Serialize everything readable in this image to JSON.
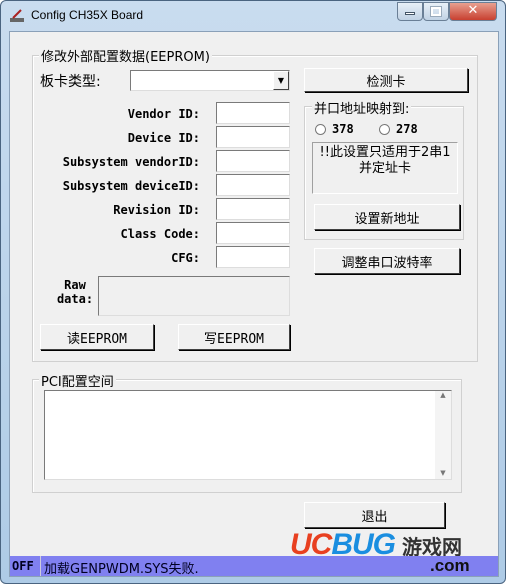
{
  "window": {
    "title": "Config CH35X Board"
  },
  "eeprom": {
    "legend": "修改外部配置数据(EEPROM)",
    "board_type_label": "板卡类型:",
    "board_type_value": "",
    "detect_button": "检测卡",
    "fields": [
      {
        "label": "Vendor ID:",
        "value": ""
      },
      {
        "label": "Device ID:",
        "value": ""
      },
      {
        "label": "Subsystem vendorID:",
        "value": ""
      },
      {
        "label": "Subsystem deviceID:",
        "value": ""
      },
      {
        "label": "Revision ID:",
        "value": ""
      },
      {
        "label": "Class Code:",
        "value": ""
      },
      {
        "label": "CFG:",
        "value": ""
      }
    ],
    "raw_label_1": "Raw",
    "raw_label_2": "data:",
    "read_button": "读EEPROM",
    "write_button": "写EEPROM"
  },
  "parallel": {
    "legend": "并口地址映射到:",
    "options": [
      "378",
      "278"
    ],
    "note": "!!此设置只适用于2串1并定址卡",
    "set_button": "设置新地址"
  },
  "baud_button": "调整串口波特率",
  "pci": {
    "legend": "PCI配置空间",
    "content": ""
  },
  "exit_button": "退出",
  "status": {
    "state": "OFF",
    "message": "加载GENPWDM.SYS失败."
  },
  "watermark": {
    "brand": "UCBUG",
    "suffix": "游戏网",
    "domain": ".com"
  }
}
